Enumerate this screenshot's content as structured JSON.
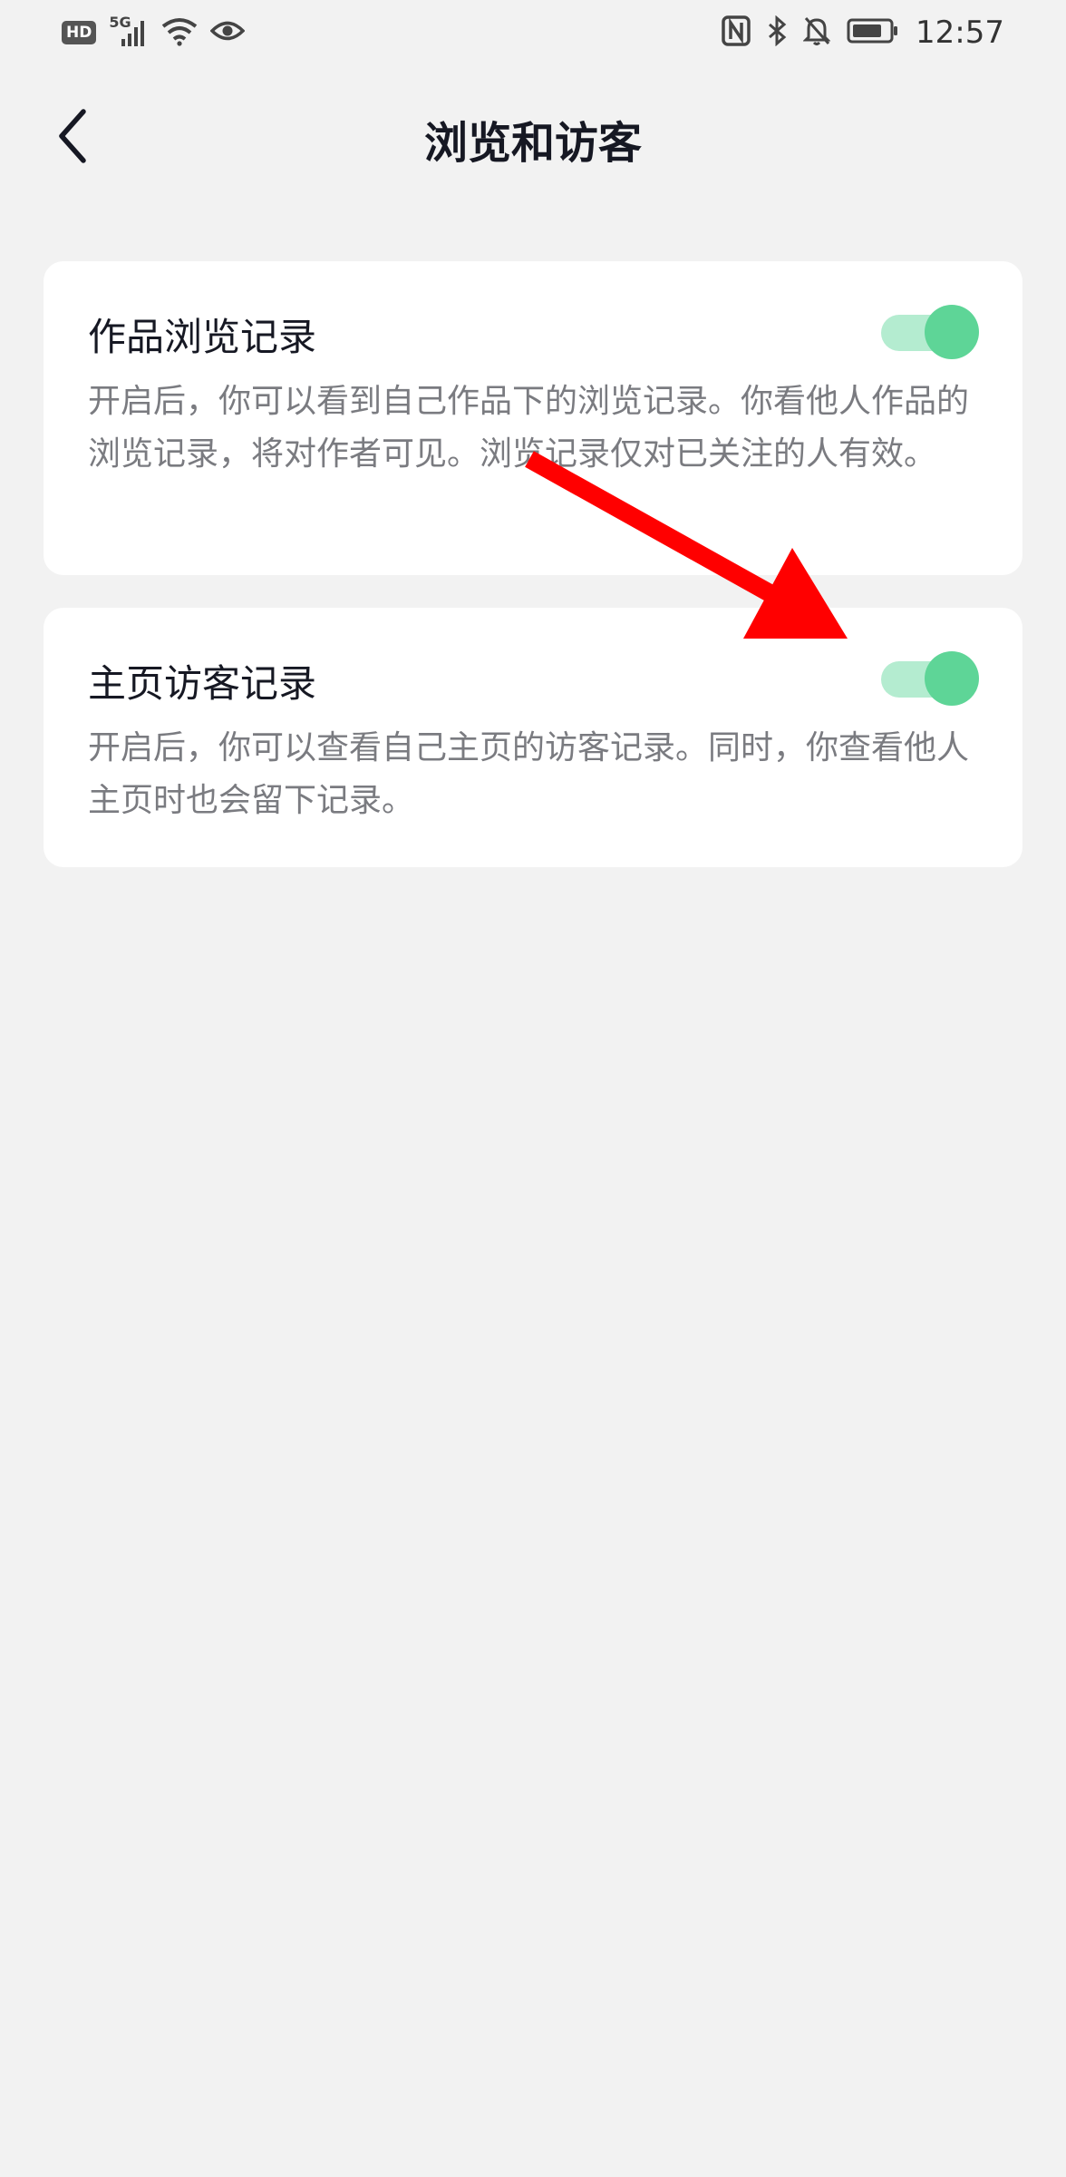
{
  "status_bar": {
    "hd_label": "HD",
    "network_label": "5G",
    "time": "12:57",
    "icons": [
      "signal-icon",
      "wifi-icon",
      "eye-icon",
      "nfc-icon",
      "bluetooth-icon",
      "mute-icon",
      "battery-icon"
    ]
  },
  "header": {
    "title": "浏览和访客",
    "back_icon": "chevron-left-icon"
  },
  "settings": [
    {
      "title": "作品浏览记录",
      "description": "开启后，你可以看到自己作品下的浏览记录。你看他人作品的浏览记录，将对作者可见。浏览记录仅对已关注的人有效。",
      "enabled": true
    },
    {
      "title": "主页访客记录",
      "description": "开启后，你可以查看自己主页的访客记录。同时，你查看他人主页时也会留下记录。",
      "enabled": true
    }
  ],
  "colors": {
    "background": "#f2f2f2",
    "card": "#ffffff",
    "toggle_on_knob": "#5ed597",
    "toggle_on_track": "#b4ecd0",
    "annotation_arrow": "#ff0000"
  }
}
